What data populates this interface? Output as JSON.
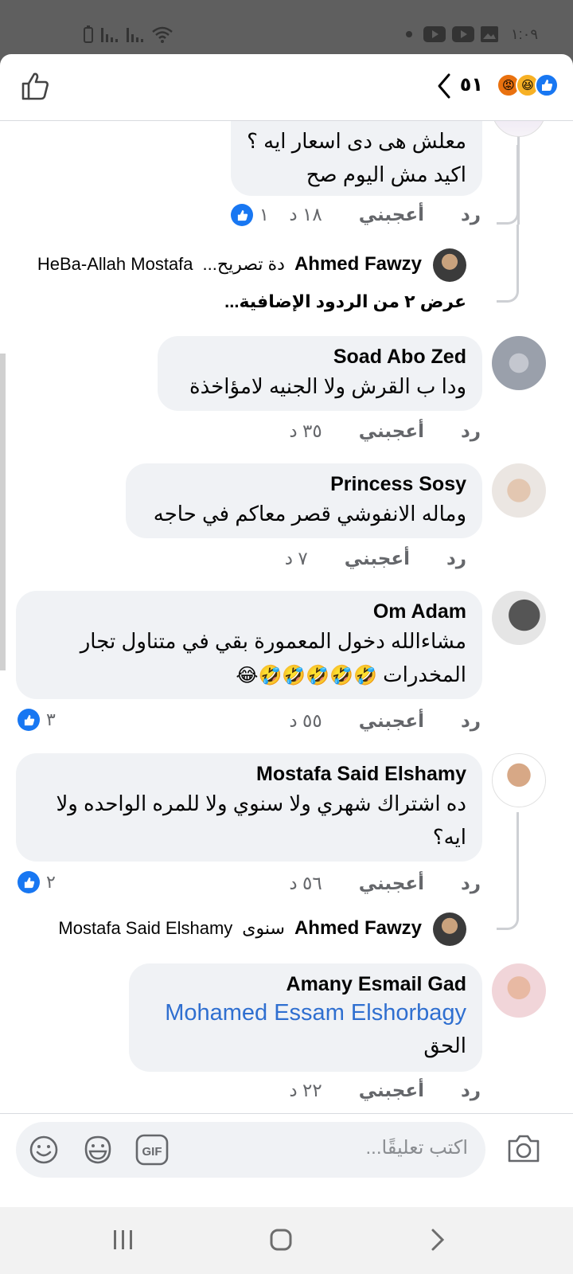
{
  "status_bar": {
    "time": "١:٠٩"
  },
  "header": {
    "reaction_count": "٥١",
    "reactions": [
      "like-reaction",
      "haha-reaction",
      "angry-reaction"
    ]
  },
  "comments": [
    {
      "id": "c0",
      "text1": "معلش هى دى اسعار ايه ؟",
      "text2": "اكيد مش اليوم صح",
      "time": "١٨ د",
      "like": "أعجبني",
      "reply": "رد",
      "likes": "١"
    },
    {
      "id": "c1",
      "name": "Soad Abo Zed",
      "text": "ودا ب القرش ولا الجنيه لامؤاخذة",
      "time": "٣٥ د",
      "like": "أعجبني",
      "reply": "رد"
    },
    {
      "id": "c2",
      "name": "Princess Sosy",
      "text": "وماله الانفوشي قصر معاكم في حاجه",
      "time": "٧ د",
      "like": "أعجبني",
      "reply": "رد"
    },
    {
      "id": "c3",
      "name": "Om Adam",
      "text1": "مشاءالله دخول المعمورة بقي في متناول تجار",
      "text2": "المخدرات",
      "emojis": "🤣🤣🤣🤣🤣😂",
      "time": "٥٥ د",
      "like": "أعجبني",
      "reply": "رد",
      "likes": "٣"
    },
    {
      "id": "c4",
      "name": "Mostafa Said Elshamy",
      "text1": "ده اشتراك شهري ولا سنوي ولا للمره الواحده ولا",
      "text2": "ايه؟",
      "time": "٥٦ د",
      "like": "أعجبني",
      "reply": "رد",
      "likes": "٢"
    },
    {
      "id": "c5",
      "name": "Amany Esmail Gad",
      "mention": "Mohamed Essam Elshorbagy",
      "text": "الحق",
      "time": "٢٢ د",
      "like": "أعجبني",
      "reply": "رد"
    }
  ],
  "replies": [
    {
      "id": "r1",
      "name": "Ahmed Fawzy",
      "text": "دة تصريح...",
      "mention": "HeBa-Allah Mostafa"
    },
    {
      "id": "r2",
      "name": "Ahmed Fawzy",
      "text": "سنوى",
      "mention": "Mostafa Said Elshamy"
    }
  ],
  "more_replies": "عرض ٢ من الردود الإضافية...",
  "compose": {
    "placeholder": "اكتب تعليقًا..."
  }
}
